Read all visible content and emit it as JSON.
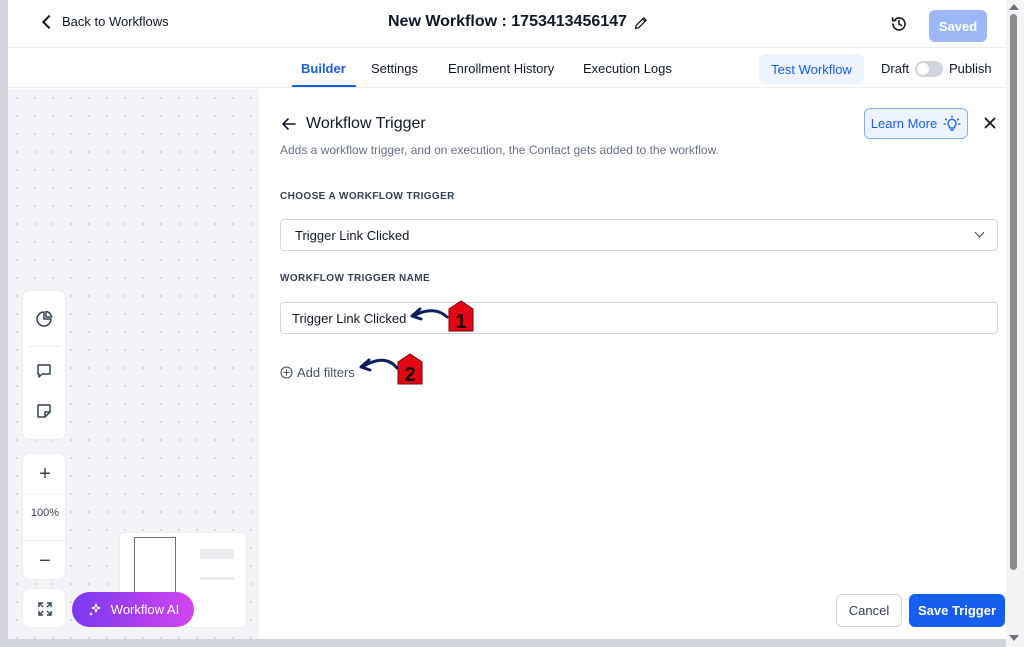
{
  "header": {
    "back_label": "Back to Workflows",
    "title": "New Workflow : 1753413456147",
    "saved_label": "Saved"
  },
  "tabs": [
    {
      "label": "Builder",
      "active": true
    },
    {
      "label": "Settings",
      "active": false
    },
    {
      "label": "Enrollment History",
      "active": false
    },
    {
      "label": "Execution Logs",
      "active": false
    }
  ],
  "actions": {
    "test_workflow": "Test Workflow",
    "draft": "Draft",
    "publish": "Publish",
    "publish_on": false
  },
  "canvas": {
    "zoom": "100%",
    "zoom_in": "+",
    "zoom_out": "−",
    "ai_button": "Workflow AI"
  },
  "drawer": {
    "title": "Workflow Trigger",
    "subtitle": "Adds a workflow trigger, and on execution, the Contact gets added to the workflow.",
    "learn_more": "Learn More",
    "choose_label": "CHOOSE A WORKFLOW TRIGGER",
    "trigger_value": "Trigger Link Clicked",
    "name_label": "WORKFLOW TRIGGER NAME",
    "name_value": "Trigger Link Clicked",
    "add_filters": "Add filters",
    "cancel": "Cancel",
    "save": "Save Trigger"
  },
  "annotations": [
    {
      "number": "1"
    },
    {
      "number": "2"
    }
  ],
  "colors": {
    "primary": "#155eef",
    "saved_disabled": "#9bb8f5",
    "annotation_red": "#e30613",
    "annotation_arrow": "#0b1f5c",
    "ai_gradient_start": "#7839ee",
    "ai_gradient_end": "#d444f1"
  }
}
